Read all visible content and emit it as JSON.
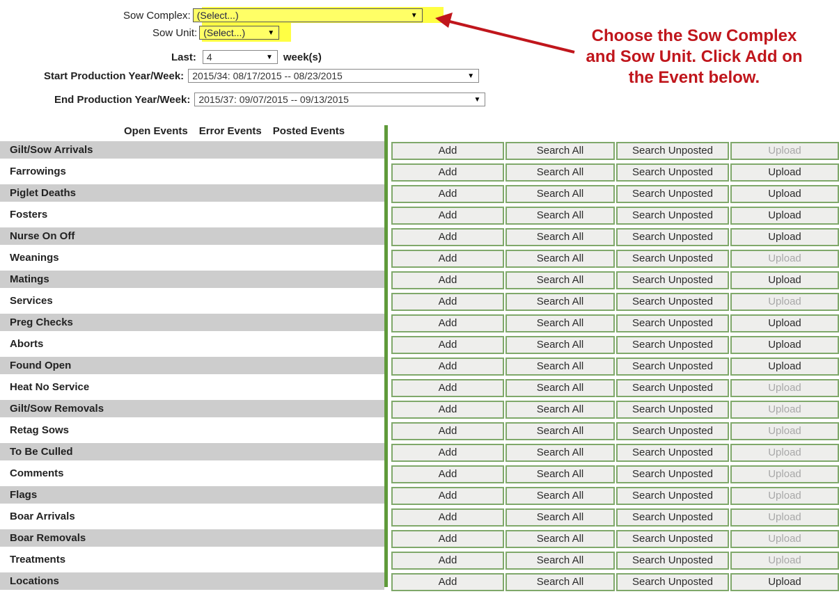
{
  "filters": {
    "sow_complex": {
      "label": "Sow Complex:",
      "value": "(Select...)"
    },
    "sow_unit": {
      "label": "Sow Unit:",
      "value": "(Select...)"
    },
    "last": {
      "label": "Last:",
      "value": "4",
      "suffix": "week(s)"
    },
    "start_week": {
      "label": "Start Production Year/Week:",
      "value": "2015/34: 08/17/2015 -- 08/23/2015"
    },
    "end_week": {
      "label": "End Production Year/Week:",
      "value": "2015/37: 09/07/2015 -- 09/13/2015"
    }
  },
  "annotation": {
    "text": "Choose the Sow Complex and Sow Unit. Click Add on the Event below.",
    "color": "#c0161c"
  },
  "columns": {
    "open": "Open Events",
    "error": "Error Events",
    "posted": "Posted Events"
  },
  "buttons": {
    "add": "Add",
    "search_all": "Search All",
    "search_unposted": "Search Unposted",
    "upload": "Upload"
  },
  "events": [
    {
      "name": "Gilt/Sow Arrivals",
      "upload_enabled": false
    },
    {
      "name": "Farrowings",
      "upload_enabled": true
    },
    {
      "name": "Piglet Deaths",
      "upload_enabled": true
    },
    {
      "name": "Fosters",
      "upload_enabled": true
    },
    {
      "name": "Nurse On Off",
      "upload_enabled": true
    },
    {
      "name": "Weanings",
      "upload_enabled": false
    },
    {
      "name": "Matings",
      "upload_enabled": true
    },
    {
      "name": "Services",
      "upload_enabled": false
    },
    {
      "name": "Preg Checks",
      "upload_enabled": true
    },
    {
      "name": "Aborts",
      "upload_enabled": true
    },
    {
      "name": "Found Open",
      "upload_enabled": true
    },
    {
      "name": "Heat No Service",
      "upload_enabled": false
    },
    {
      "name": "Gilt/Sow Removals",
      "upload_enabled": false
    },
    {
      "name": "Retag Sows",
      "upload_enabled": false
    },
    {
      "name": "To Be Culled",
      "upload_enabled": false
    },
    {
      "name": "Comments",
      "upload_enabled": false
    },
    {
      "name": "Flags",
      "upload_enabled": false
    },
    {
      "name": "Boar Arrivals",
      "upload_enabled": false
    },
    {
      "name": "Boar Removals",
      "upload_enabled": false
    },
    {
      "name": "Treatments",
      "upload_enabled": false
    },
    {
      "name": "Locations",
      "upload_enabled": true
    }
  ],
  "colors": {
    "highlight": "#ffff44",
    "separator": "#5f9a3a",
    "button_border": "#7fa86a",
    "shaded_row": "#cdcdcd"
  }
}
